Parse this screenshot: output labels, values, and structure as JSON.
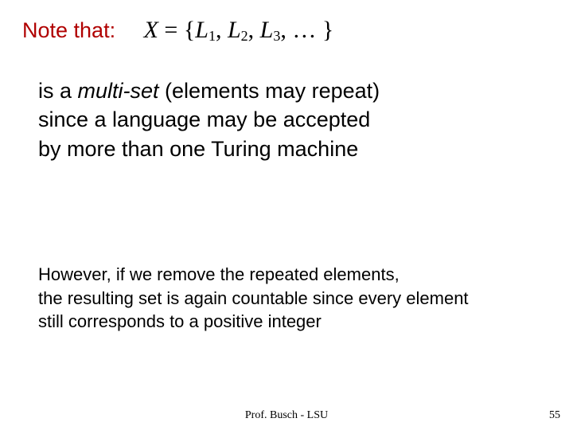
{
  "heading": {
    "note_that": "Note that:",
    "math_var": "X",
    "math_eq": "=",
    "math_open": "{",
    "math_L": "L",
    "math_comma": ",",
    "math_ellipsis": "…",
    "math_close": "}",
    "sub1": "1",
    "sub2": "2",
    "sub3": "3"
  },
  "body1": {
    "l1a": "is a ",
    "l1b": "multi-set",
    "l1c": " (elements may repeat)",
    "l2": "since a language may be accepted",
    "l3": "by more than one Turing machine"
  },
  "body2": {
    "l1": "However, if we remove the repeated elements,",
    "l2": "the resulting set is again countable since every element",
    "l3": "still corresponds to a positive integer"
  },
  "footer": "Prof. Busch - LSU",
  "page": "55"
}
